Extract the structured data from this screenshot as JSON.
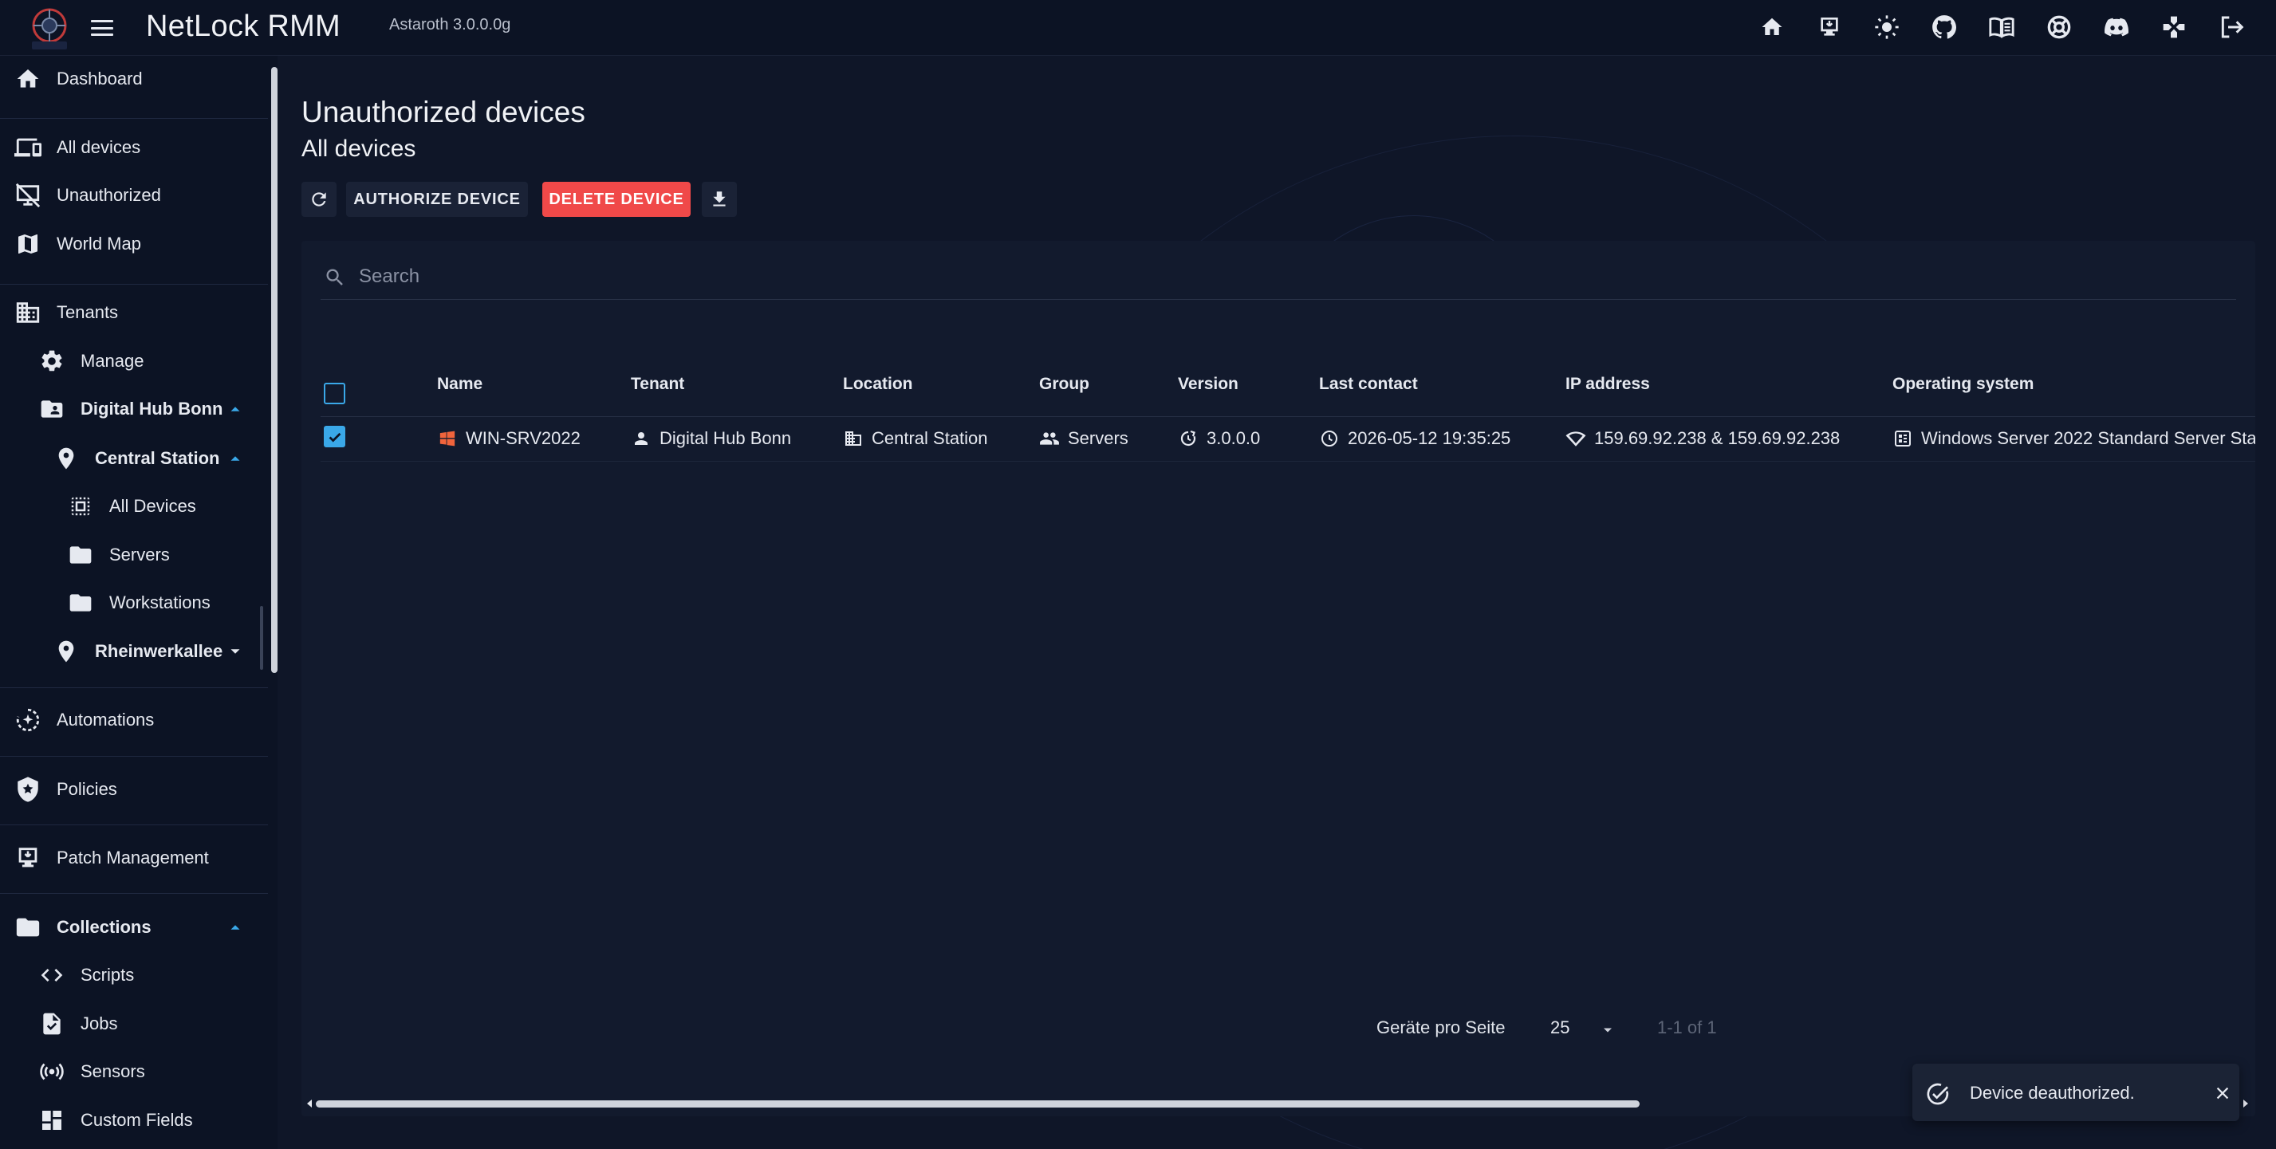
{
  "header": {
    "title": "NetLock RMM",
    "version": "Astaroth 3.0.0.0g",
    "icons": [
      "home-icon",
      "install-icon",
      "theme-toggle-icon",
      "github-icon",
      "docs-icon",
      "support-icon",
      "discord-icon",
      "gamepad-icon",
      "logout-icon"
    ]
  },
  "sidebar": {
    "items": [
      {
        "label": "Dashboard",
        "icon": "home-icon"
      },
      {
        "label": "All devices",
        "icon": "devices-icon"
      },
      {
        "label": "Unauthorized",
        "icon": "monitor-off-icon"
      },
      {
        "label": "World Map",
        "icon": "map-icon"
      },
      {
        "label": "Tenants",
        "icon": "building-icon"
      },
      {
        "label": "Manage",
        "icon": "gear-icon"
      },
      {
        "label": "Digital Hub Bonn",
        "icon": "folder-user-icon"
      },
      {
        "label": "Central Station",
        "icon": "location-pin-icon"
      },
      {
        "label": "All Devices",
        "icon": "select-all-icon"
      },
      {
        "label": "Servers",
        "icon": "folder-icon"
      },
      {
        "label": "Workstations",
        "icon": "folder-icon"
      },
      {
        "label": "Rheinwerkallee",
        "icon": "location-pin-icon"
      },
      {
        "label": "Automations",
        "icon": "automation-icon"
      },
      {
        "label": "Policies",
        "icon": "shield-icon"
      },
      {
        "label": "Patch Management",
        "icon": "patch-icon"
      },
      {
        "label": "Collections",
        "icon": "folder-icon"
      },
      {
        "label": "Scripts",
        "icon": "code-icon"
      },
      {
        "label": "Jobs",
        "icon": "job-icon"
      },
      {
        "label": "Sensors",
        "icon": "sensor-icon"
      },
      {
        "label": "Custom Fields",
        "icon": "dashboard-icon"
      }
    ]
  },
  "main": {
    "title": "Unauthorized devices",
    "subtitle": "All devices",
    "toolbar": {
      "authorize_label": "AUTHORIZE DEVICE",
      "delete_label": "DELETE DEVICE"
    },
    "search": {
      "placeholder": "Search",
      "value": ""
    },
    "table": {
      "columns": [
        "Name",
        "Tenant",
        "Location",
        "Group",
        "Version",
        "Last contact",
        "IP address",
        "Operating system"
      ],
      "rows": [
        {
          "selected": true,
          "name": "WIN-SRV2022",
          "tenant": "Digital Hub Bonn",
          "location": "Central Station",
          "group": "Servers",
          "version": "3.0.0.0",
          "last_contact": "2026-05-12 19:35:25",
          "ip": "159.69.92.238 & 159.69.92.238",
          "os": "Windows Server 2022 Standard Server Sta"
        }
      ]
    },
    "pagination": {
      "rows_per_page_label": "Geräte pro Seite",
      "rows_per_page": "25",
      "page_info": "1-1 of 1"
    }
  },
  "toast": {
    "message": "Device deauthorized."
  },
  "colors": {
    "accent": "#3aa8e8",
    "danger": "#f04949",
    "windows": "#f0643c",
    "background": "#0f1628"
  }
}
